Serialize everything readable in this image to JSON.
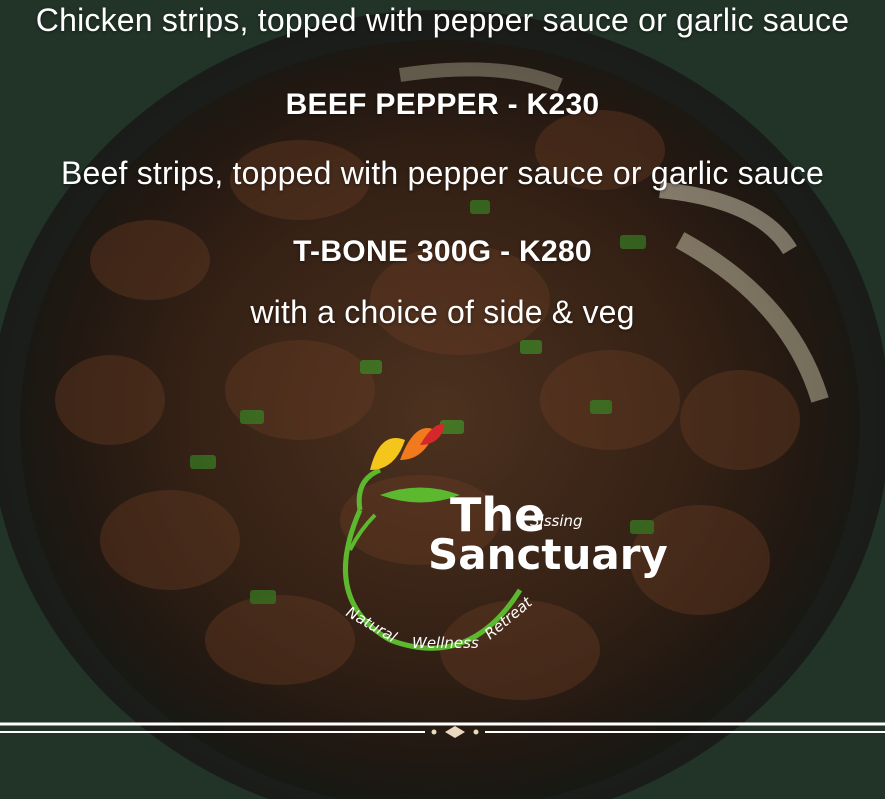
{
  "menu": {
    "chicken_desc": "Chicken strips, topped with pepper sauce or garlic sauce",
    "beef_title": "BEEF PEPPER - K230",
    "beef_desc": "Beef strips, topped with pepper sauce or garlic sauce",
    "tbone_title": "T-BONE 300G - K280",
    "tbone_desc": "with a choice of side & veg"
  },
  "logo": {
    "the": "The",
    "small_word": "Sissing",
    "main_word": "Sanctuary",
    "tagline": [
      "Natural",
      "Wellness",
      "Retreat"
    ]
  },
  "colors": {
    "background": "#24352a",
    "text": "#ffffff",
    "logo_green": "#5cb82f",
    "logo_yellow": "#f4c51a",
    "logo_orange": "#f07a1c",
    "logo_red": "#d6272a"
  },
  "icons": [
    "bird-of-paradise-flower-icon",
    "diamond-ornament-icon"
  ]
}
